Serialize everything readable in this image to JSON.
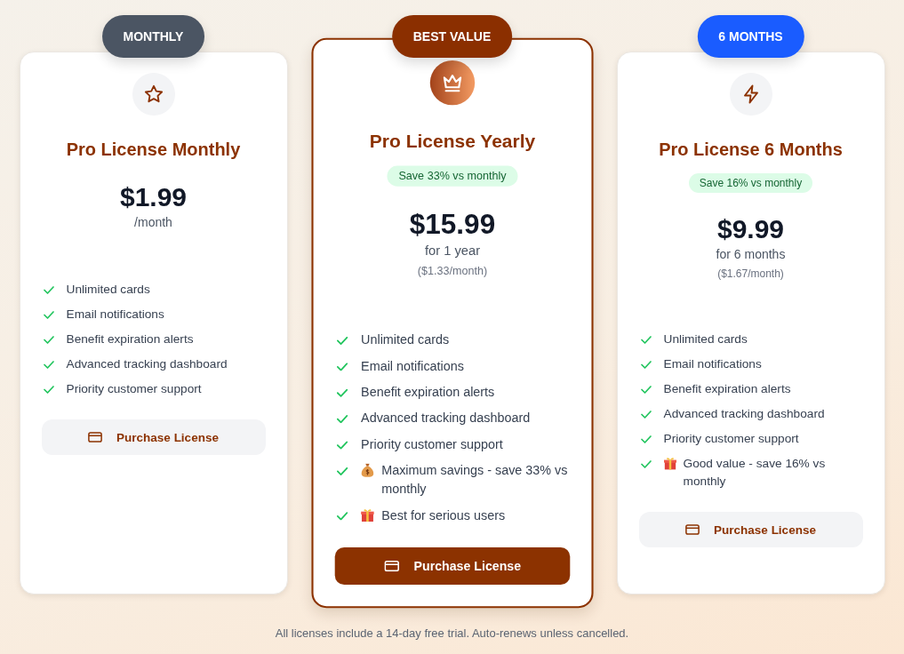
{
  "plans": [
    {
      "badge": {
        "label": "MONTHLY",
        "color": "#4b5563"
      },
      "featured": false,
      "title": "Pro License Monthly",
      "price": "$1.99",
      "period": "/month",
      "features": [
        {
          "kind": "plain",
          "text": "Unlimited cards"
        },
        {
          "kind": "plain",
          "text": "Email notifications"
        },
        {
          "kind": "plain",
          "text": "Benefit expiration alerts"
        },
        {
          "kind": "plain",
          "text": "Advanced tracking dashboard"
        },
        {
          "kind": "plain",
          "text": "Priority customer support"
        }
      ],
      "button": "Purchase License"
    },
    {
      "badge": {
        "label": "BEST VALUE",
        "color": "#8b2f00"
      },
      "featured": true,
      "title": "Pro License Yearly",
      "savings": "Save 33% vs monthly",
      "price": "$15.99",
      "period": "for 1 year",
      "per_month": "($1.33/month)",
      "features": [
        {
          "kind": "plain",
          "text": "Unlimited cards"
        },
        {
          "kind": "plain",
          "text": "Email notifications"
        },
        {
          "kind": "plain",
          "text": "Benefit expiration alerts"
        },
        {
          "kind": "plain",
          "text": "Advanced tracking dashboard"
        },
        {
          "kind": "plain",
          "text": "Priority customer support"
        },
        {
          "kind": "money-bag",
          "text": "Maximum savings - save 33% vs monthly"
        },
        {
          "kind": "gift",
          "text": "Best for serious users"
        }
      ],
      "button": "Purchase License"
    },
    {
      "badge": {
        "label": "6 MONTHS",
        "color": "#1a5cff"
      },
      "featured": false,
      "title": "Pro License 6 Months",
      "savings": "Save 16% vs monthly",
      "price": "$9.99",
      "period": "for 6 months",
      "per_month": "($1.67/month)",
      "features": [
        {
          "kind": "plain",
          "text": "Unlimited cards"
        },
        {
          "kind": "plain",
          "text": "Email notifications"
        },
        {
          "kind": "plain",
          "text": "Benefit expiration alerts"
        },
        {
          "kind": "plain",
          "text": "Advanced tracking dashboard"
        },
        {
          "kind": "plain",
          "text": "Priority customer support"
        },
        {
          "kind": "gift",
          "text": "Good value - save 16% vs monthly"
        }
      ],
      "button": "Purchase License"
    }
  ],
  "footnote": "All licenses include a 14-day free trial. Auto-renews unless cancelled."
}
